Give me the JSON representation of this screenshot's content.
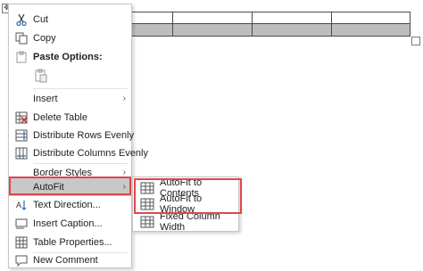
{
  "document": {
    "move_handle_glyph": "✥"
  },
  "context_menu": {
    "cut": "Cut",
    "copy": "Copy",
    "paste_options": "Paste Options:",
    "insert": "Insert",
    "delete_table": "Delete Table",
    "distribute_rows": "Distribute Rows Evenly",
    "distribute_columns": "Distribute Columns Evenly",
    "border_styles": "Border Styles",
    "autofit": "AutoFit",
    "text_direction": "Text Direction...",
    "insert_caption": "Insert Caption...",
    "table_properties": "Table Properties...",
    "new_comment": "New Comment",
    "submenu_arrow": "›"
  },
  "autofit_submenu": {
    "autofit_contents": "AutoFit to Contents",
    "autofit_window": "AutoFit to Window",
    "fixed_width": "Fixed Column Width"
  },
  "colors": {
    "highlight_outline": "#e0464b",
    "hover_background": "#c8c8c8",
    "icon_blue": "#2b6cb0",
    "icon_red": "#c0392b"
  }
}
